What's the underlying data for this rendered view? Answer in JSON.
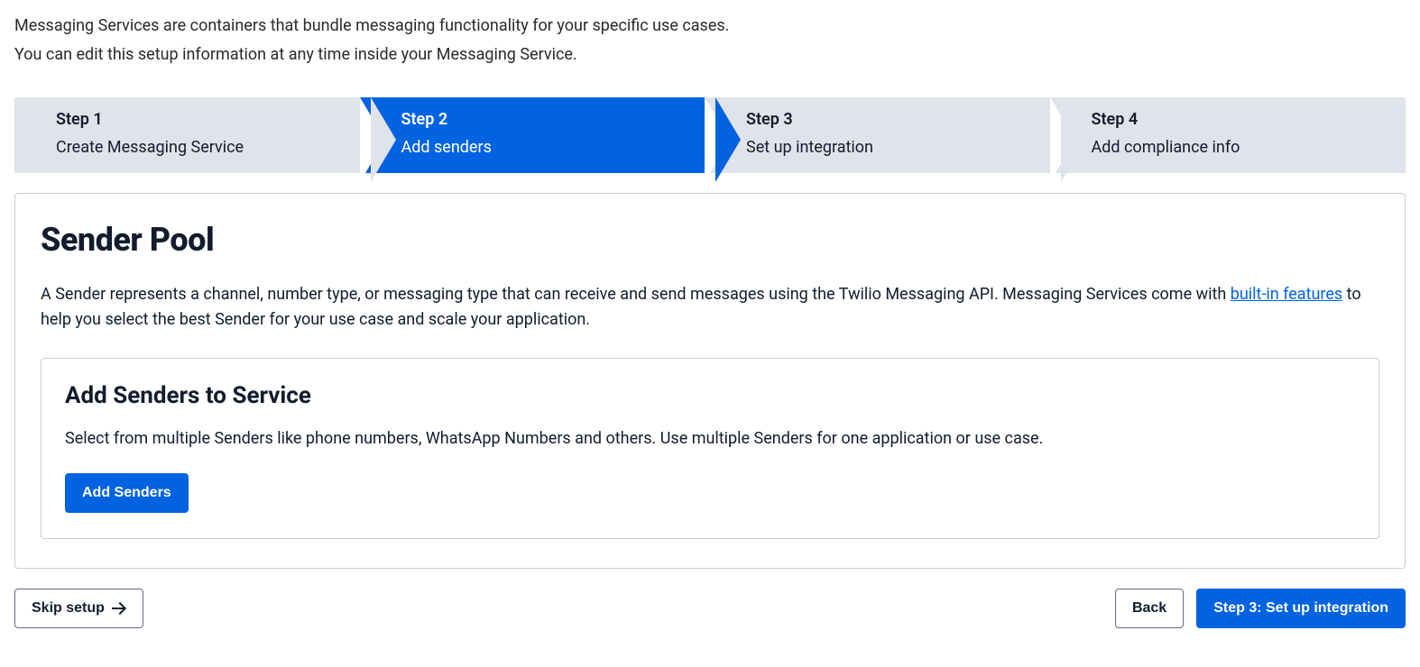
{
  "intro": {
    "line1": "Messaging Services are containers that bundle messaging functionality for your specific use cases.",
    "line2": "You can edit this setup information at any time inside your Messaging Service."
  },
  "steps": [
    {
      "title": "Step 1",
      "sub": "Create Messaging Service",
      "active": false
    },
    {
      "title": "Step 2",
      "sub": "Add senders",
      "active": true
    },
    {
      "title": "Step 3",
      "sub": "Set up integration",
      "active": false
    },
    {
      "title": "Step 4",
      "sub": "Add compliance info",
      "active": false
    }
  ],
  "main": {
    "heading": "Sender Pool",
    "description_pre": "A Sender represents a channel, number type, or messaging type that can receive and send messages using the Twilio Messaging API. Messaging Services come with ",
    "description_link": "built-in features",
    "description_post": " to help you select the best Sender for your use case and scale your application.",
    "subcard": {
      "heading": "Add Senders to Service",
      "description": "Select from multiple Senders like phone numbers, WhatsApp Numbers and others. Use multiple Senders for one application or use case.",
      "button": "Add Senders"
    }
  },
  "footer": {
    "skip": "Skip setup",
    "back": "Back",
    "next": "Step 3: Set up integration"
  }
}
